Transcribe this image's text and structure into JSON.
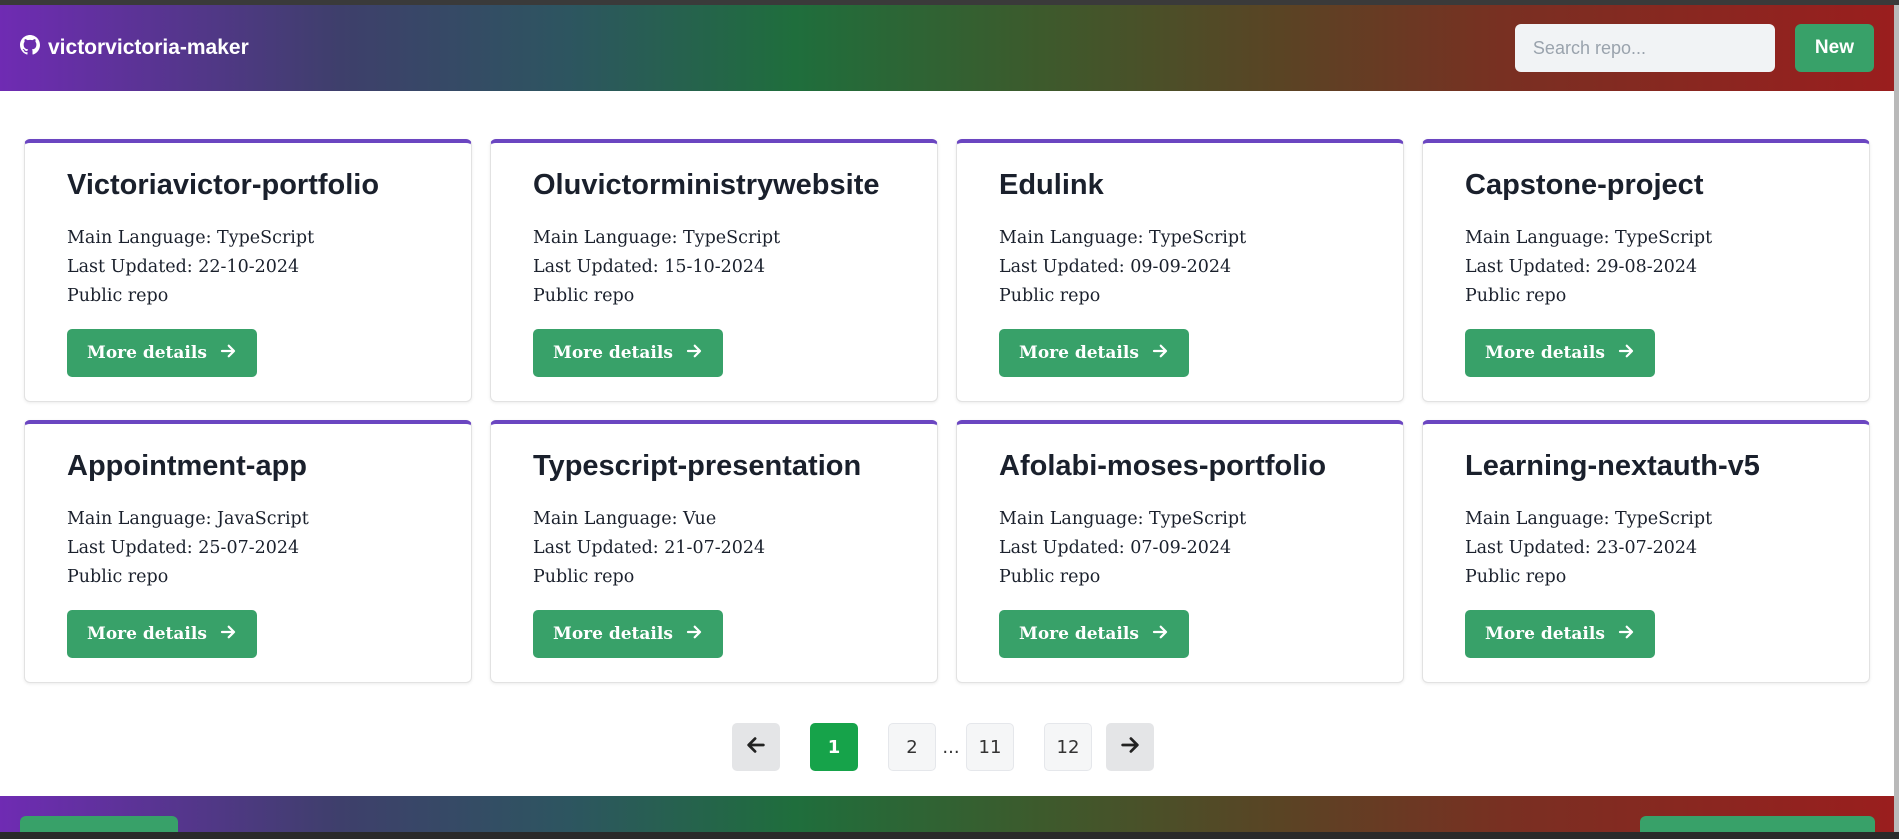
{
  "header": {
    "username": "victorvictoria-maker",
    "search_placeholder": "Search repo...",
    "new_label": "New"
  },
  "repos": [
    {
      "name": "Victoriavictor-portfolio",
      "language": "Main Language: TypeScript",
      "updated": "Last Updated: 22-10-2024",
      "visibility": "Public repo",
      "button": "More details"
    },
    {
      "name": "Oluvictorministrywebsite",
      "language": "Main Language: TypeScript",
      "updated": "Last Updated: 15-10-2024",
      "visibility": "Public repo",
      "button": "More details"
    },
    {
      "name": "Edulink",
      "language": "Main Language: TypeScript",
      "updated": "Last Updated: 09-09-2024",
      "visibility": "Public repo",
      "button": "More details"
    },
    {
      "name": "Capstone-project",
      "language": "Main Language: TypeScript",
      "updated": "Last Updated: 29-08-2024",
      "visibility": "Public repo",
      "button": "More details"
    },
    {
      "name": "Appointment-app",
      "language": "Main Language: JavaScript",
      "updated": "Last Updated: 25-07-2024",
      "visibility": "Public repo",
      "button": "More details"
    },
    {
      "name": "Typescript-presentation",
      "language": "Main Language: Vue",
      "updated": "Last Updated: 21-07-2024",
      "visibility": "Public repo",
      "button": "More details"
    },
    {
      "name": "Afolabi-moses-portfolio",
      "language": "Main Language: TypeScript",
      "updated": "Last Updated: 07-09-2024",
      "visibility": "Public repo",
      "button": "More details"
    },
    {
      "name": "Learning-nextauth-v5",
      "language": "Main Language: TypeScript",
      "updated": "Last Updated: 23-07-2024",
      "visibility": "Public repo",
      "button": "More details"
    }
  ],
  "pagination": {
    "pages": [
      "1",
      "2",
      "11",
      "12"
    ],
    "ellipsis": "...",
    "active": "1"
  },
  "icons": {
    "brand": "github-icon",
    "details": "arrow-right-icon",
    "prev": "arrow-left-icon",
    "next": "arrow-right-icon"
  },
  "colors": {
    "accent_green": "#38a169",
    "card_border_top": "#6b46c1",
    "active_page": "#16a34a"
  }
}
